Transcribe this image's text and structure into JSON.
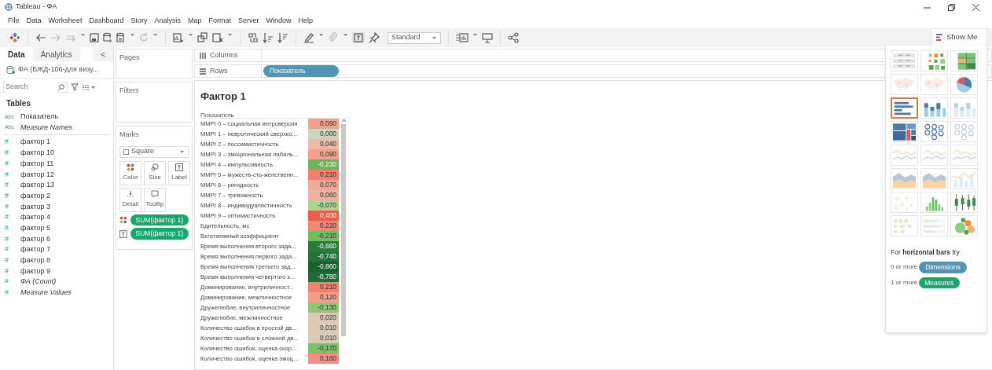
{
  "window": {
    "title": "Tableau - ФА"
  },
  "menu": [
    "File",
    "Data",
    "Worksheet",
    "Dashboard",
    "Story",
    "Analysis",
    "Map",
    "Format",
    "Server",
    "Window",
    "Help"
  ],
  "toolbar": {
    "fit_dropdown": "Standard"
  },
  "data_pane": {
    "tabs": [
      {
        "label": "Data",
        "selected": true
      },
      {
        "label": "Analytics",
        "selected": false
      }
    ],
    "collapse": "<",
    "data_source": "ФА (БЖД-106-для визу...",
    "search": {
      "placeholder": "Search"
    },
    "tables_heading": "Tables",
    "fields": [
      {
        "kind": "dimension",
        "icon_text": "Abc",
        "label": "Показатель",
        "italic": false
      },
      {
        "kind": "dimension",
        "icon_text": "Abc",
        "label": "Measure Names",
        "italic": true
      },
      {
        "kind": "measure",
        "icon_text": "#",
        "label": "фактор 1",
        "italic": false
      },
      {
        "kind": "measure",
        "icon_text": "#",
        "label": "фактор 10",
        "italic": false
      },
      {
        "kind": "measure",
        "icon_text": "#",
        "label": "фактор 11",
        "italic": false
      },
      {
        "kind": "measure",
        "icon_text": "#",
        "label": "фактор 12",
        "italic": false
      },
      {
        "kind": "measure",
        "icon_text": "#",
        "label": "фактор 13",
        "italic": false
      },
      {
        "kind": "measure",
        "icon_text": "#",
        "label": "фактор 2",
        "italic": false
      },
      {
        "kind": "measure",
        "icon_text": "#",
        "label": "фактор 3",
        "italic": false
      },
      {
        "kind": "measure",
        "icon_text": "#",
        "label": "фактор 4",
        "italic": false
      },
      {
        "kind": "measure",
        "icon_text": "#",
        "label": "фактор 5",
        "italic": false
      },
      {
        "kind": "measure",
        "icon_text": "#",
        "label": "фактор 6",
        "italic": false
      },
      {
        "kind": "measure",
        "icon_text": "#",
        "label": "фактор 7",
        "italic": false
      },
      {
        "kind": "measure",
        "icon_text": "#",
        "label": "фактор 8",
        "italic": false
      },
      {
        "kind": "measure",
        "icon_text": "#",
        "label": "фактор 9",
        "italic": false
      },
      {
        "kind": "measure",
        "icon_text": "#",
        "label": "ФА (Count)",
        "italic": true
      },
      {
        "kind": "measure",
        "icon_text": "#",
        "label": "Measure Values",
        "italic": true
      }
    ]
  },
  "cards": {
    "pages": "Pages",
    "filters": "Filters",
    "marks": {
      "title": "Marks",
      "mark_type": "Square",
      "buttons": [
        {
          "kind": "color",
          "label": "Color"
        },
        {
          "kind": "size",
          "label": "Size"
        },
        {
          "kind": "label",
          "label": "Label"
        },
        {
          "kind": "detail",
          "label": "Detail"
        },
        {
          "kind": "tooltip",
          "label": "Tooltip"
        }
      ],
      "pills": [
        {
          "kind": "color",
          "label": "SUM(фактор 1)"
        },
        {
          "kind": "label",
          "label": "SUM(фактор 1)"
        }
      ]
    }
  },
  "shelves": {
    "columns": {
      "label": "Columns"
    },
    "rows": {
      "label": "Rows",
      "pills": [
        "Показатель"
      ]
    }
  },
  "sheet": {
    "title": "Фактор 1",
    "column_header": "Показатель",
    "rows": [
      {
        "label": "MMPI 0 – социальная интроверсия",
        "value": "0,090",
        "color": "#f4a090"
      },
      {
        "label": "MMPI 1 – невротический сверхко...",
        "value": "0,000",
        "color": "#ccd5bd"
      },
      {
        "label": "MMPI 2 – пессимистичность",
        "value": "0,040",
        "color": "#e9bba9"
      },
      {
        "label": "MMPI 3 – эмоциональная лабиль...",
        "value": "0,090",
        "color": "#f4a090"
      },
      {
        "label": "MMPI 4 – импульсивность",
        "value": "-0,230",
        "color": "#6db35a"
      },
      {
        "label": "MMPI 5 – мужеств-сть-женственн...",
        "value": "0,210",
        "color": "#f08070"
      },
      {
        "label": "MMPI 6 – ригидность",
        "value": "0,070",
        "color": "#f0a898"
      },
      {
        "label": "MMPI 7 – тревожность",
        "value": "0,060",
        "color": "#eeb0a0"
      },
      {
        "label": "MMPI 8 – индивидуалистичность",
        "value": "-0,070",
        "color": "#a8d890"
      },
      {
        "label": "MMPI 9 – оптимистичность",
        "value": "0,400",
        "color": "#e8604c"
      },
      {
        "label": "Бдительность, мс",
        "value": "0,220",
        "color": "#f08878"
      },
      {
        "label": "Вегетативный коэффициент",
        "value": "-0,210",
        "color": "#74bb60"
      },
      {
        "label": "Время выполнения второго зада...",
        "value": "-0,660",
        "color": "#2a7a3c"
      },
      {
        "label": "Время выполнения первого зада...",
        "value": "-0,740",
        "color": "#237238"
      },
      {
        "label": "Время выполнения третьего зад...",
        "value": "-0,860",
        "color": "#1a6030"
      },
      {
        "label": "Время выполнения четвертого з...",
        "value": "-0,780",
        "color": "#1f6a35"
      },
      {
        "label": "Доминирование, внутриличност...",
        "value": "0,210",
        "color": "#f08070"
      },
      {
        "label": "Доминирование, межличностное",
        "value": "0,120",
        "color": "#f49c88"
      },
      {
        "label": "Дружелюбие, внутриличностное",
        "value": "-0,130",
        "color": "#8cc878"
      },
      {
        "label": "Дружелюбие, межличностное",
        "value": "0,020",
        "color": "#dcc8b4"
      },
      {
        "label": "Количество ошибок в простой дв...",
        "value": "0,010",
        "color": "#d8ccb8"
      },
      {
        "label": "Количество ошибок в сложной дв...",
        "value": "0,010",
        "color": "#d8ccb8"
      },
      {
        "label": "Количество ошибок, оценка скор...",
        "value": "-0,170",
        "color": "#80c06c"
      },
      {
        "label": "Количество ошибок, оценка эмоц...",
        "value": "0,160",
        "color": "#f09080"
      }
    ]
  },
  "show_me": {
    "tab": "Show Me",
    "thumbnails": [
      {
        "kind": "texttable",
        "selected": false,
        "disabled": false
      },
      {
        "kind": "heatmap",
        "selected": false,
        "disabled": false
      },
      {
        "kind": "highlighttable",
        "selected": false,
        "disabled": false
      },
      {
        "kind": "map",
        "selected": false,
        "disabled": true
      },
      {
        "kind": "map",
        "selected": false,
        "disabled": true
      },
      {
        "kind": "pie",
        "selected": false,
        "disabled": false
      },
      {
        "kind": "hbar",
        "selected": true,
        "disabled": false
      },
      {
        "kind": "vbar",
        "selected": false,
        "disabled": false
      },
      {
        "kind": "vbar",
        "selected": false,
        "disabled": true
      },
      {
        "kind": "treemap",
        "selected": false,
        "disabled": false
      },
      {
        "kind": "circles",
        "selected": false,
        "disabled": false
      },
      {
        "kind": "circles",
        "selected": false,
        "disabled": true
      },
      {
        "kind": "line",
        "selected": false,
        "disabled": true
      },
      {
        "kind": "line",
        "selected": false,
        "disabled": true
      },
      {
        "kind": "line",
        "selected": false,
        "disabled": true
      },
      {
        "kind": "area",
        "selected": false,
        "disabled": false
      },
      {
        "kind": "area",
        "selected": false,
        "disabled": false
      },
      {
        "kind": "combo",
        "selected": false,
        "disabled": true
      },
      {
        "kind": "scatter",
        "selected": false,
        "disabled": true
      },
      {
        "kind": "histogram",
        "selected": false,
        "disabled": false
      },
      {
        "kind": "boxplot",
        "selected": false,
        "disabled": false
      },
      {
        "kind": "gantt",
        "selected": false,
        "disabled": true
      },
      {
        "kind": "bullet",
        "selected": false,
        "disabled": true
      },
      {
        "kind": "bubbles",
        "selected": false,
        "disabled": false
      }
    ],
    "hint": "For **horizontal bars** try",
    "requirements": [
      {
        "kind": "dimension",
        "prefix": "0 or more",
        "pill": "Dimensions"
      },
      {
        "kind": "measure",
        "prefix": "1 or more",
        "pill": "Measures"
      }
    ]
  }
}
